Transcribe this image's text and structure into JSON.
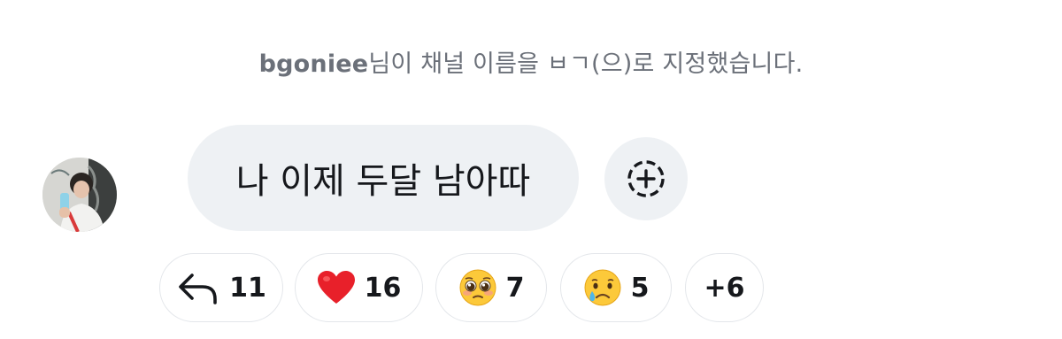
{
  "system_notice": {
    "username": "bgoniee",
    "text": "님이 채널 이름을 ㅂㄱ(으)로 지정했습니다."
  },
  "message": {
    "text": "나 이제 두달 남아따"
  },
  "add_reaction": {
    "icon": "add-reaction-icon"
  },
  "reactions": [
    {
      "icon": "reply-icon",
      "count": "11"
    },
    {
      "icon": "red-heart-emoji",
      "count": "16"
    },
    {
      "icon": "pleading-face-emoji",
      "count": "7"
    },
    {
      "icon": "crying-face-emoji",
      "count": "5"
    },
    {
      "label": "+6"
    }
  ],
  "colors": {
    "bubble_background": "#eef1f4",
    "notice_text": "#6b7079",
    "heart": "#e8202a",
    "chip_border": "#e3e6ea"
  }
}
